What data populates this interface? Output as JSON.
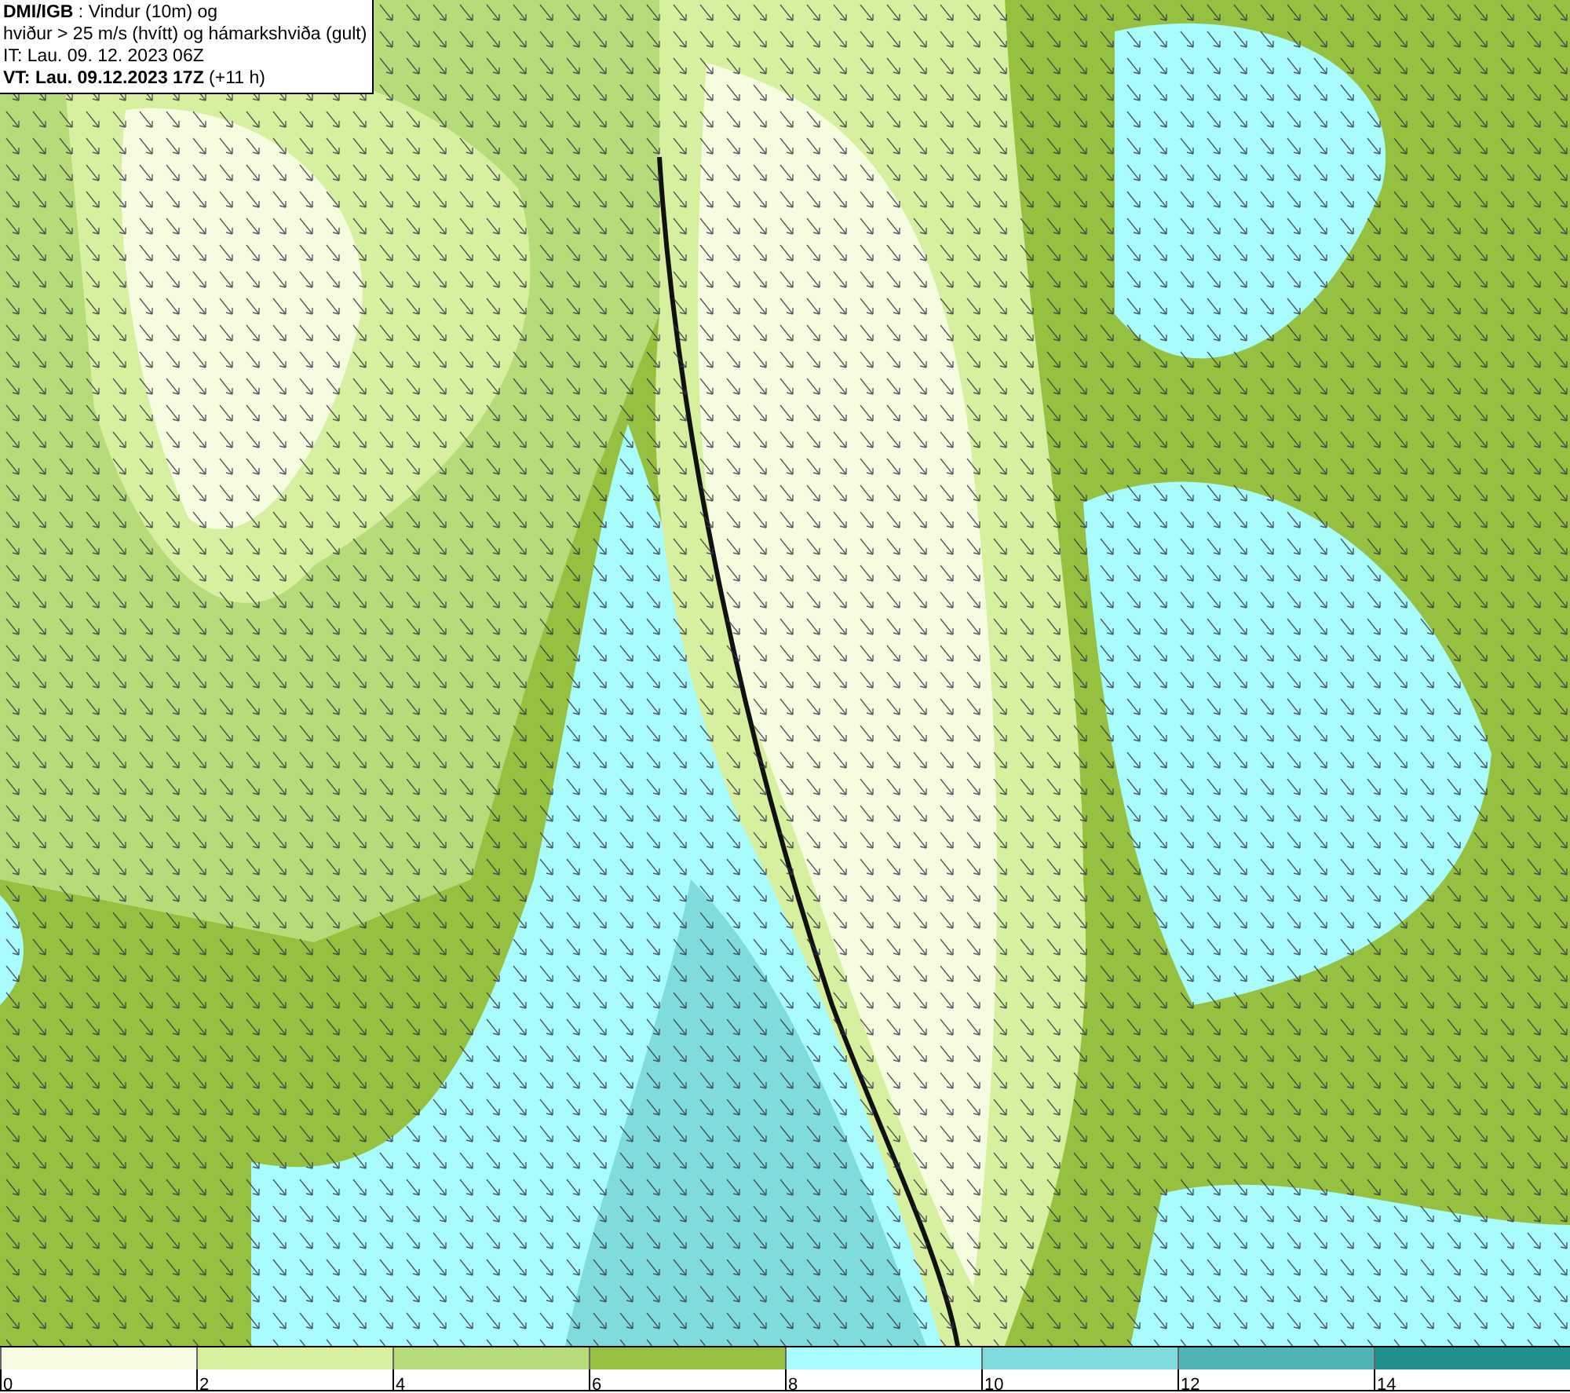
{
  "header": {
    "lines": [
      "**DMI/IGB** : Vindur (10m) og",
      "hviður > 25 m/s (hvítt) og hámarkshviða (gult)",
      "IT: Lau. 09. 12. 2023 06Z",
      "**VT: Lau. 09.12.2023 17Z** (+11 h)"
    ]
  },
  "legend": {
    "bins": [
      {
        "color": "#f5fce0"
      },
      {
        "color": "#d7f0a0"
      },
      {
        "color": "#b5dc78"
      },
      {
        "color": "#96c040"
      },
      {
        "color": "#a8fcfc"
      },
      {
        "color": "#80dcdc"
      },
      {
        "color": "#50b4b4"
      },
      {
        "color": "#20908c"
      }
    ],
    "labels": [
      "0",
      "2",
      "4",
      "6",
      "8",
      "10",
      "12",
      "14"
    ]
  }
}
